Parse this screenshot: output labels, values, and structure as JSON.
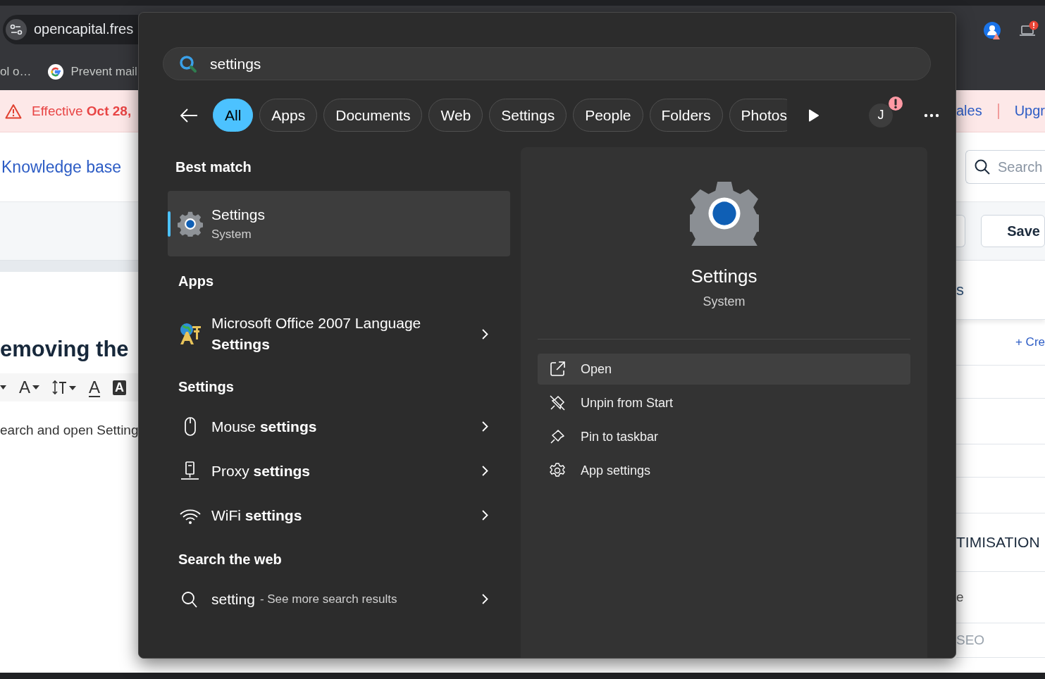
{
  "browser": {
    "address": "opencapital.fres",
    "bookmarks": [
      {
        "label": "ol o…",
        "kind": "plain"
      },
      {
        "label": "Prevent mail",
        "kind": "google"
      }
    ]
  },
  "page_left": {
    "banner": "Effective **Oct 28,**",
    "breadcrumb": "Knowledge base",
    "heading": "emoving the",
    "toolbar": [
      {
        "kind": "caret"
      },
      {
        "kind": "font-size",
        "glyph": "A"
      },
      {
        "kind": "line-height"
      },
      {
        "kind": "font-color",
        "glyph": "A"
      },
      {
        "kind": "highlight",
        "glyph": "A"
      }
    ],
    "body": "earch and open Setting"
  },
  "page_right": {
    "banner_links": [
      "ales",
      "Upgr"
    ],
    "search": {
      "placeholder": "Search"
    },
    "save": "Save",
    "section_title": "s",
    "create_link": "+ Cre",
    "section_heading": "TIMISATION",
    "row_text": "e",
    "field_text": "SEO"
  },
  "search_panel": {
    "query": "settings",
    "filters": [
      {
        "label": "All",
        "selected": true
      },
      {
        "label": "Apps",
        "selected": false
      },
      {
        "label": "Documents",
        "selected": false
      },
      {
        "label": "Web",
        "selected": false
      },
      {
        "label": "Settings",
        "selected": false
      },
      {
        "label": "People",
        "selected": false
      },
      {
        "label": "Folders",
        "selected": false
      },
      {
        "label": "Photos",
        "selected": false
      }
    ],
    "account_initial": "J",
    "best_match": {
      "heading": "Best match",
      "name": "Settings",
      "subtitle": "System",
      "selected": true
    },
    "apps": {
      "heading": "Apps",
      "items": [
        {
          "name": "Microsoft Office 2007 Language **Settings**",
          "kind": "language",
          "selected": false
        }
      ]
    },
    "settings": {
      "heading": "Settings",
      "items": [
        {
          "name": "Mouse **settings**",
          "kind": "mouse",
          "selected": false
        },
        {
          "name": "Proxy **settings**",
          "kind": "proxy",
          "selected": false
        },
        {
          "name": "WiFi **settings**",
          "kind": "wifi",
          "selected": false
        }
      ]
    },
    "web": {
      "heading": "Search the web",
      "query": "setting",
      "hint": "- See more search results",
      "selected": false
    },
    "preview": {
      "title": "Settings",
      "subtitle": "System",
      "actions": [
        {
          "label": "Open",
          "kind": "open",
          "selected": true
        },
        {
          "label": "Unpin from Start",
          "kind": "unpin",
          "selected": false
        },
        {
          "label": "Pin to taskbar",
          "kind": "pin",
          "selected": false
        },
        {
          "label": "App settings",
          "kind": "gear",
          "selected": false
        }
      ]
    }
  }
}
